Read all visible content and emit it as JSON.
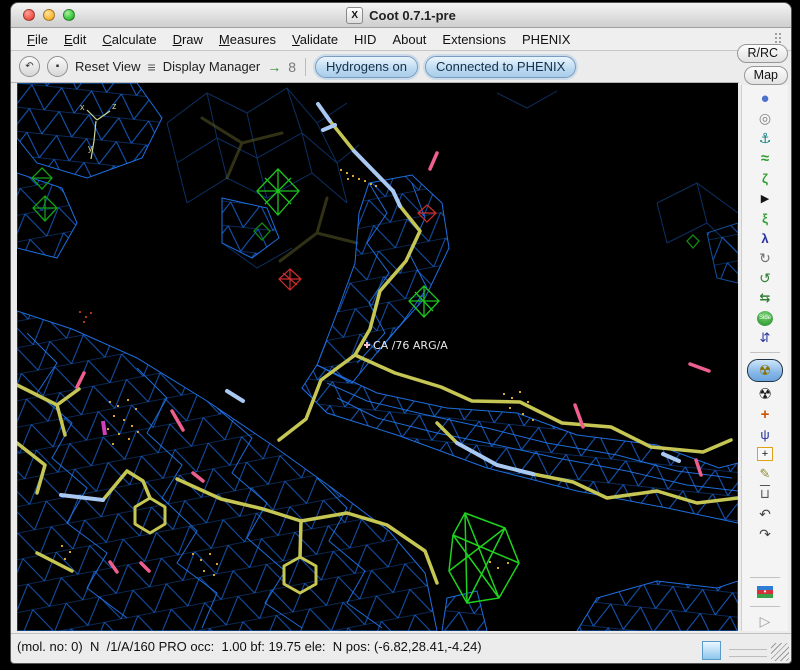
{
  "window": {
    "title": "Coot 0.7.1-pre",
    "icon_letter": "X"
  },
  "menu": {
    "items": [
      {
        "label": "File"
      },
      {
        "label": "Edit"
      },
      {
        "label": "Calculate"
      },
      {
        "label": "Draw"
      },
      {
        "label": "Measures"
      },
      {
        "label": "Validate"
      },
      {
        "label": "HID"
      },
      {
        "label": "About"
      },
      {
        "label": "Extensions"
      },
      {
        "label": "PHENIX"
      }
    ]
  },
  "toolbar": {
    "back_glyph": "↶",
    "target_glyph": "▪",
    "reset_view": "Reset View",
    "display_manager_glyph": "≡",
    "display_manager": "Display Manager",
    "arrow_glyph": "→",
    "molecule_glyph": "8",
    "hydrogens_label": "Hydrogens on",
    "phenix_label": "Connected to PHENIX"
  },
  "corner_buttons": {
    "rrc": "R/RC",
    "map": "Map"
  },
  "rightbar": {
    "icons": [
      {
        "glyph": "●",
        "style": "color:#4a72c8;font-size:15px"
      },
      {
        "glyph": "◎",
        "style": "color:#808080;font-size:14px"
      },
      {
        "glyph": "⚓",
        "style": "color:#0e7d7d;font-size:14px"
      },
      {
        "glyph": "≈",
        "style": "color:#2e9e2e;font-weight:bold;font-size:15px"
      },
      {
        "glyph": "ζ",
        "style": "color:#2e9e2e;font-weight:bold;font-size:13px"
      },
      {
        "glyph": "▶",
        "style": "color:#151515;font-size:11px"
      },
      {
        "glyph": "ξ",
        "style": "color:#2e9e2e;font-weight:bold;font-size:13px"
      },
      {
        "glyph": "λ",
        "style": "color:#28329e;font-weight:bold;font-size:13px"
      },
      {
        "glyph": "↻",
        "style": "color:#707070;font-size:14px"
      },
      {
        "glyph": "↺",
        "style": "color:#2e7d32;font-size:14px"
      },
      {
        "glyph": "⇆",
        "style": "color:#2e7d32;font-weight:bold;font-size:13px"
      },
      {
        "glyph": "Side",
        "style": "color:#fff;background:radial-gradient(circle at 50% 30%,#7ad47a,#1f8a1f);border-radius:50%;font-size:6px;padding:5px 2px;line-height:5px"
      },
      {
        "glyph": "⇵",
        "style": "color:#28329e;font-size:13px"
      },
      {
        "glyph": "☢",
        "style": "color:#8a7000;font-size:14px"
      },
      {
        "glyph": "☢",
        "style": "color:#1a1a1a;font-size:15px"
      },
      {
        "glyph": "+",
        "style": "color:#cc5500;font-weight:bold;font-size:15px"
      },
      {
        "glyph": "ψ",
        "style": "color:#28329e;font-size:13px"
      },
      {
        "glyph": "+",
        "style": "color:#111;border:1.5px solid #e0a018;padding:0 4px;font-size:11px;line-height:12px;background:#f8f8f8"
      },
      {
        "glyph": "✎",
        "style": "color:#8a8a30;font-size:13px"
      },
      {
        "glyph": "⊔",
        "style": "color:#555;text-decoration:overline;font-size:13px"
      },
      {
        "glyph": "↶",
        "style": "color:#454545;font-size:14px"
      },
      {
        "glyph": "↷",
        "style": "color:#454545;font-size:14px"
      },
      {
        "glyph": "•",
        "style": "color:#fff;font-size:8px;background:linear-gradient(#2e7dd4 33%,#d83038 33%,#d83038 66%,#3aa048 66%);padding:3px 7px;line-height:6px"
      },
      {
        "glyph": "▷",
        "style": "color:#9a9a9a;font-size:14px"
      }
    ]
  },
  "canvas": {
    "atom_label": "CA /76 ARG/A",
    "axes": {
      "x": "x",
      "y": "y",
      "z": "z"
    },
    "colors": {
      "background": "#000000",
      "map_2fofc_blue": "#1b6ae0",
      "map_dim_blue": "#0d2f63",
      "difference_positive_green": "#1ec41e",
      "difference_negative_red": "#cf2d2d",
      "model_carbon_yellow": "#c6c655",
      "model_nitrogen_blue": "#a9c9f2",
      "model_oxygen_pink": "#ee5f8f",
      "water_dots_yellow": "#d8a62a",
      "axes_label": "#ccd69a",
      "atom_label_white": "#e8e8e8"
    }
  },
  "statusbar": {
    "text": "(mol. no: 0)  N  /1/A/160 PRO occ:  1.00 bf: 19.75 ele:  N pos: (-6.82,28.41,-4.24)"
  }
}
